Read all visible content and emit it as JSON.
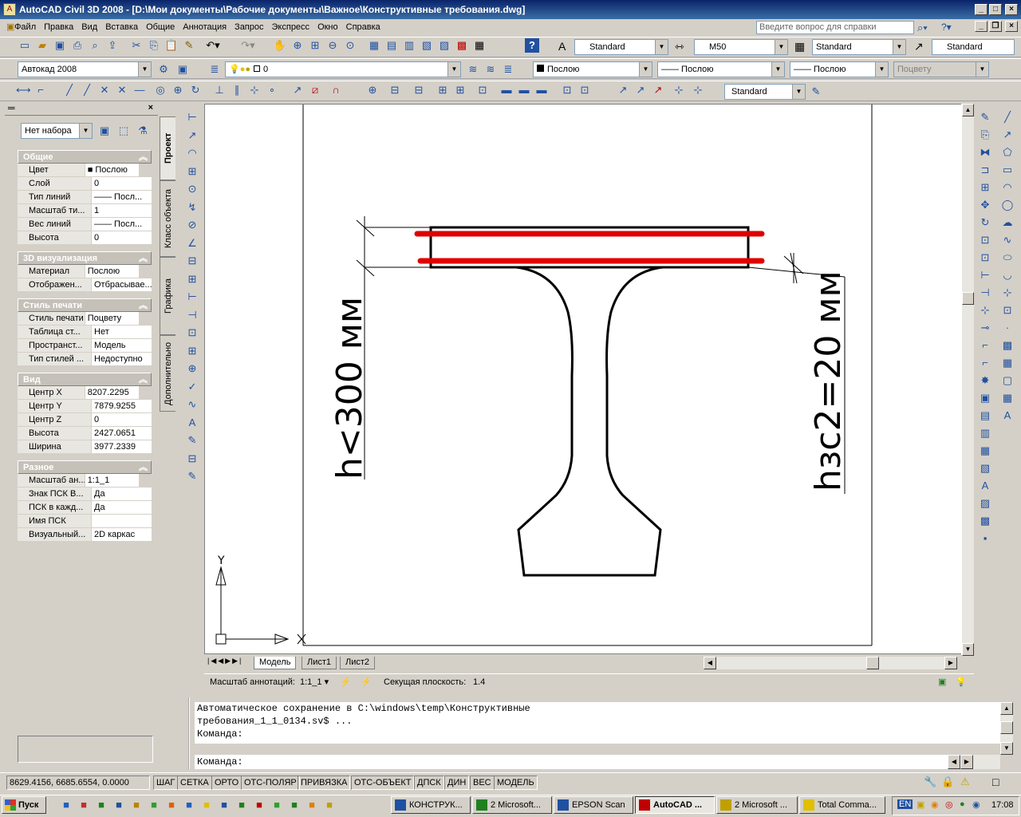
{
  "window": {
    "title": "AutoCAD Civil 3D 2008 - [D:\\Мои документы\\Рабочие документы\\Важное\\Конструктивные требования.dwg]"
  },
  "menu": [
    "Файл",
    "Правка",
    "Вид",
    "Вставка",
    "Общие",
    "Аннотация",
    "Запрос",
    "Экспресс",
    "Окно",
    "Справка"
  ],
  "help_placeholder": "Введите вопрос для справки",
  "styles": {
    "text": "Standard",
    "dim": "M50",
    "table": "Standard",
    "mleader": "Standard"
  },
  "workspace": "Автокад 2008",
  "layer": "0",
  "props": {
    "color": "Послою",
    "linetype": "—— Послою",
    "lineweight": "—— Послою",
    "plotstyle": "Поцвету"
  },
  "dim_style2": "Standard",
  "palette": {
    "filter": "Нет набора",
    "sections": [
      {
        "title": "Общие",
        "rows": [
          [
            "Цвет",
            "■ Послою"
          ],
          [
            "Слой",
            "0"
          ],
          [
            "Тип линий",
            "—— Посл..."
          ],
          [
            "Масштаб ти...",
            "1"
          ],
          [
            "Вес линий",
            "—— Посл..."
          ],
          [
            "Высота",
            "0"
          ]
        ]
      },
      {
        "title": "3D визуализация",
        "rows": [
          [
            "Материал",
            "Послою"
          ],
          [
            "Отображен...",
            "Отбрасывае..."
          ]
        ]
      },
      {
        "title": "Стиль печати",
        "rows": [
          [
            "Стиль печати",
            "Поцвету"
          ],
          [
            "Таблица ст...",
            "Нет"
          ],
          [
            "Пространст...",
            "Модель"
          ],
          [
            "Тип стилей ...",
            "Недоступно"
          ]
        ]
      },
      {
        "title": "Вид",
        "rows": [
          [
            "Центр X",
            "8207.2295"
          ],
          [
            "Центр Y",
            "7879.9255"
          ],
          [
            "Центр Z",
            "0"
          ],
          [
            "Высота",
            "2427.0651"
          ],
          [
            "Ширина",
            "3977.2339"
          ]
        ]
      },
      {
        "title": "Разное",
        "rows": [
          [
            "Масштаб ан...",
            "1:1_1"
          ],
          [
            "Знак ПСК В...",
            "Да"
          ],
          [
            "ПСК в кажд...",
            "Да"
          ],
          [
            "Имя ПСК",
            ""
          ],
          [
            "Визуальный...",
            "2D каркас"
          ]
        ]
      }
    ],
    "tabs": [
      "Проект",
      "Класс объекта",
      "Графика",
      "Дополнительно"
    ]
  },
  "drawing": {
    "label_left": "h<300 мм",
    "label_right": "hзс2=20 мм",
    "axis_y": "Y"
  },
  "layout_tabs": [
    "Модель",
    "Лист1",
    "Лист2"
  ],
  "annot": {
    "scale_label": "Масштаб аннотаций:",
    "scale": "1:1_1",
    "section_label": "Секущая плоскость:",
    "section": "1.4"
  },
  "command": {
    "history": [
      "Автоматическое сохранение в C:\\windows\\temp\\Конструктивные",
      "требования_1_1_0134.sv$ ...",
      "Команда:"
    ],
    "prompt": "Команда:"
  },
  "status": {
    "coords": "8629.4156, 6685.6554, 0.0000",
    "buttons": [
      "ШАГ",
      "СЕТКА",
      "ОРТО",
      "ОТС-ПОЛЯР",
      "ПРИВЯЗКА",
      "ОТС-ОБЪЕКТ",
      "ДПСК",
      "ДИН",
      "ВЕС",
      "МОДЕЛЬ"
    ]
  },
  "taskbar": {
    "start": "Пуск",
    "tasks": [
      "КОНСТРУК...",
      "2 Microsoft...",
      "EPSON Scan",
      "AutoCAD ...",
      "2 Microsoft ...",
      "Total Comma..."
    ],
    "lang": "EN",
    "time": "17:08"
  }
}
